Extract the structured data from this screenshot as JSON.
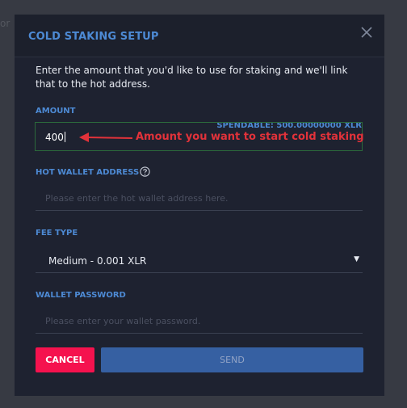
{
  "background": {
    "text": "or"
  },
  "modal": {
    "title": "COLD STAKING SETUP",
    "intro": "Enter the amount that you'd like to use for staking and we'll link that to the hot address.",
    "amount": {
      "label": "AMOUNT",
      "spendable": "SPENDABLE: 500.00000000 XLR",
      "value": "400",
      "annotation": "Amount you want to start cold staking"
    },
    "hot_wallet": {
      "label": "HOT WALLET ADDRESS",
      "placeholder": "Please enter the hot wallet address here."
    },
    "fee_type": {
      "label": "FEE TYPE",
      "selected": "Medium - 0.001 XLR"
    },
    "password": {
      "label": "WALLET PASSWORD",
      "placeholder": "Please enter your wallet password."
    },
    "buttons": {
      "cancel": "CANCEL",
      "send": "SEND"
    }
  },
  "colors": {
    "accent": "#4d8ad4",
    "cancel": "#f5124e",
    "send": "#3660a2",
    "annotation": "#e2323a"
  },
  "icons": [
    "close-icon",
    "help-circle-icon",
    "dropdown-arrow-icon",
    "arrow-left-icon"
  ]
}
